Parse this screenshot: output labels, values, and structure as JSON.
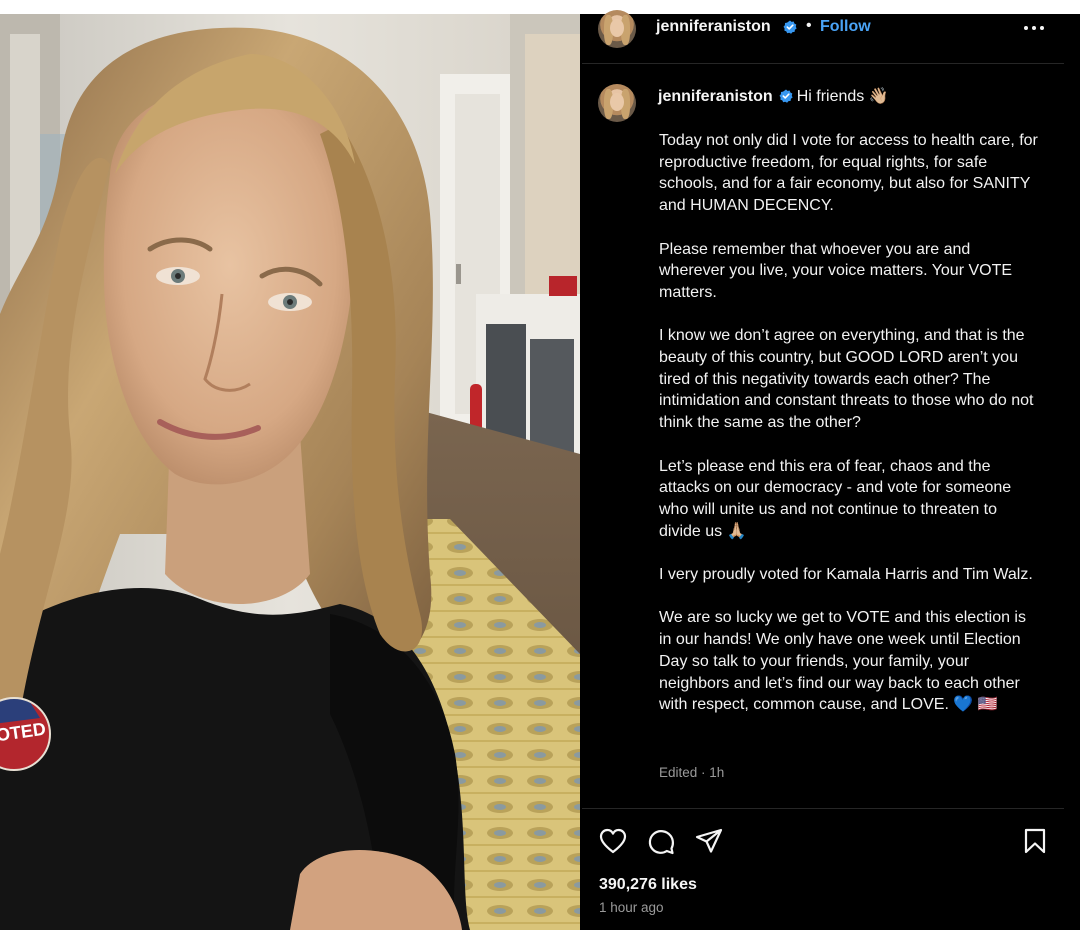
{
  "post": {
    "image_alt": "Selfie of a woman with blonde hair in a black t-shirt wearing a round \"I Voted\" sticker",
    "sticker_text": "OTED"
  },
  "header": {
    "username": "jenniferaniston",
    "separator": "•",
    "follow_label": "Follow",
    "verified_icon": "verified-badge-icon",
    "more_icon": "more-options-icon"
  },
  "caption": {
    "username": "jenniferaniston",
    "greeting": "Hi friends 👋🏼",
    "paragraphs": [
      "Today not only did I vote for access to health care, for reproductive freedom, for equal rights, for safe schools, and for a fair economy, but also for SANITY and HUMAN DECENCY.",
      "Please remember that whoever you are and wherever you live, your voice matters. Your VOTE matters.",
      "I know we don’t agree on everything, and that is the beauty of this country, but GOOD LORD aren’t you tired of this negativity towards each other? The intimidation and constant threats to those who do not think the same as the other?",
      "Let’s please end this era of fear, chaos and the attacks on our democracy - and vote for someone who will unite us and not continue to threaten to divide us 🙏🏼",
      "I very proudly voted for Kamala Harris and Tim Walz.",
      "We are so lucky we get to VOTE and this election is in our hands! We only have one week until Election Day so talk to your friends, your family, your neighbors and let’s find our way back to each other with respect, common cause, and LOVE. 💙 🇺🇸"
    ],
    "edited": "Edited · 1h"
  },
  "actions": {
    "like_icon": "heart-icon",
    "comment_icon": "comment-icon",
    "share_icon": "share-icon",
    "save_icon": "bookmark-icon"
  },
  "stats": {
    "likes": "390,276 likes",
    "time_ago": "1 hour ago"
  },
  "colors": {
    "background": "#000000",
    "text": "#f5f5f5",
    "muted": "#9a9a9a",
    "follow_blue": "#4aa3f5",
    "verified_blue": "#3797f0",
    "divider": "#262626"
  }
}
